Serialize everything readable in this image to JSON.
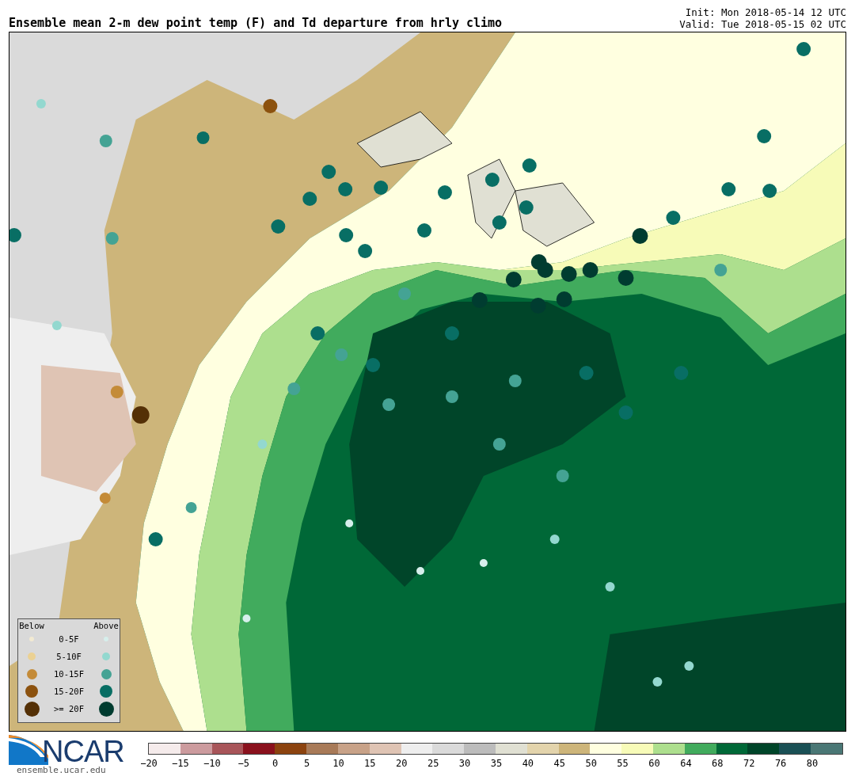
{
  "title": "Ensemble mean 2-m dew point temp (F) and Td departure from hrly climo",
  "init": "Init: Mon 2018-05-14 12 UTC",
  "valid": "Valid: Tue 2018-05-15 02 UTC",
  "legend": {
    "below_heading": "Below",
    "above_heading": "Above",
    "rows": [
      {
        "label": "0-5F",
        "dots": [
          {
            "color": "#f2ead2"
          },
          {
            "color": "#d6efec"
          }
        ]
      },
      {
        "label": "5-10F",
        "dots": [
          {
            "color": "#ebd193"
          },
          {
            "color": "#93d8cf"
          }
        ]
      },
      {
        "label": "10-15F",
        "dots": [
          {
            "color": "#c48b38"
          },
          {
            "color": "#44a394"
          }
        ]
      },
      {
        "label": "15-20F",
        "dots": [
          {
            "color": "#8c520f"
          },
          {
            "color": "#086e64"
          }
        ]
      },
      {
        "label": ">= 20F",
        "dots": [
          {
            "color": "#543006"
          },
          {
            "color": "#003c30"
          }
        ]
      }
    ]
  },
  "logo": {
    "name": "NCAR",
    "url": "ensemble.ucar.edu"
  },
  "colorbar": {
    "segments": [
      {
        "color": "#f5ebeb"
      },
      {
        "color": "#cc9b9e"
      },
      {
        "color": "#a85559"
      },
      {
        "color": "#8a111d"
      },
      {
        "color": "#8c430f"
      },
      {
        "color": "#a87a58"
      },
      {
        "color": "#c8a288"
      },
      {
        "color": "#dfc4b4"
      },
      {
        "color": "#eeeeee"
      },
      {
        "color": "#dadada"
      },
      {
        "color": "#bcbcbc"
      },
      {
        "color": "#e0e0d3"
      },
      {
        "color": "#e3d4ac"
      },
      {
        "color": "#cdb57a"
      },
      {
        "color": "#ffffe0"
      },
      {
        "color": "#f7fbb8"
      },
      {
        "color": "#addf8e"
      },
      {
        "color": "#41ab5d"
      },
      {
        "color": "#006837"
      },
      {
        "color": "#004529"
      },
      {
        "color": "#1a5055"
      },
      {
        "color": "#4a7775"
      }
    ],
    "ticks": [
      "−20",
      "−15",
      "−10",
      "−5",
      "0",
      "5",
      "10",
      "15",
      "20",
      "25",
      "30",
      "35",
      "40",
      "45",
      "50",
      "55",
      "60",
      "64",
      "68",
      "72",
      "76",
      "80"
    ]
  }
}
